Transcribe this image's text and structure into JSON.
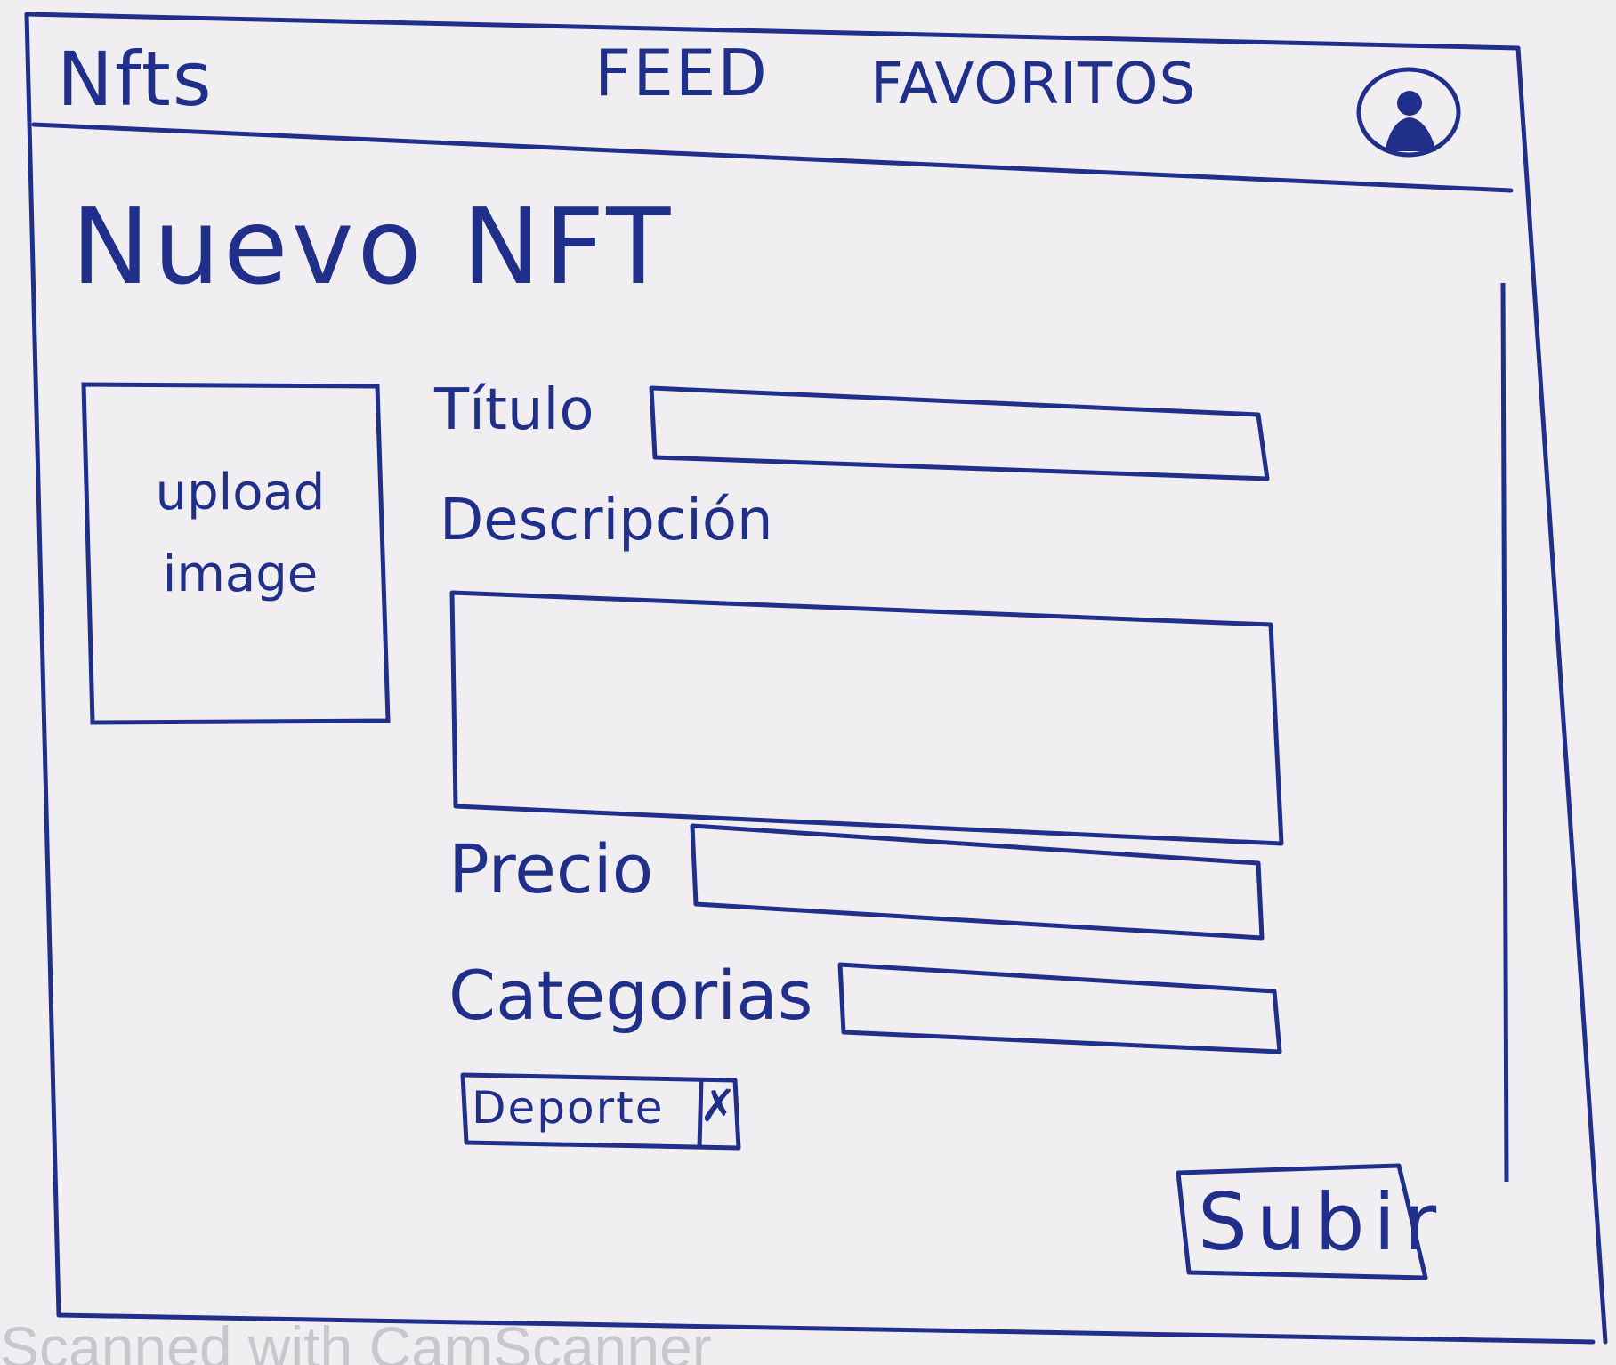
{
  "header": {
    "logo": "Nfts",
    "nav": [
      {
        "label": "FEED"
      },
      {
        "label": "FAVORITOS"
      }
    ]
  },
  "main": {
    "title": "Nuevo NFT",
    "upload": {
      "label": "upload image"
    },
    "form": {
      "titulo_label": "Título",
      "titulo_value": "",
      "descripcion_label": "Descripción",
      "descripcion_value": "",
      "precio_label": "Precio",
      "precio_value": "",
      "categorias_label": "Categorias",
      "categorias_value": "",
      "selected_categories": [
        {
          "label": "Deporte",
          "remove": "✗"
        }
      ]
    },
    "submit_label": "Subir"
  },
  "watermark": "Scanned with CamScanner",
  "colors": {
    "ink": "#1f2f8a",
    "paper": "#f1eef1",
    "watermark": "#c9c7cb"
  }
}
